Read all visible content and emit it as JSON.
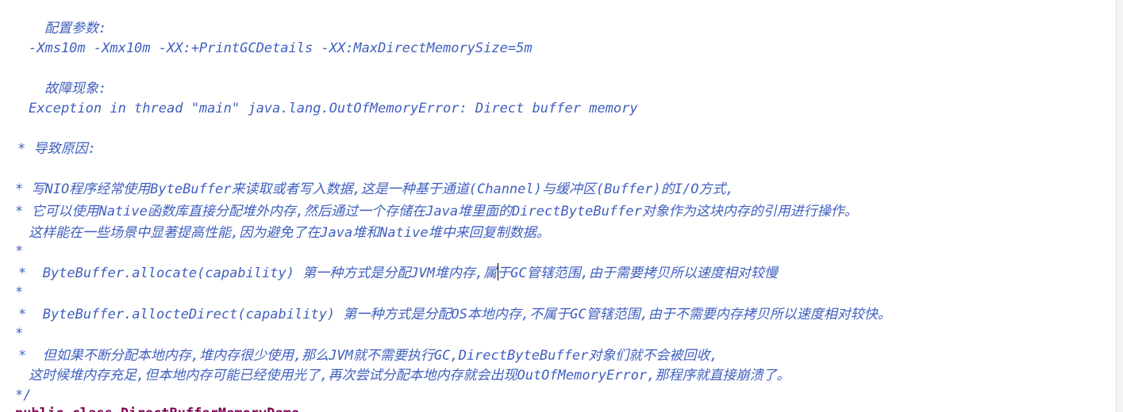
{
  "editor": {
    "text_color": "#3f5fbf",
    "lines": [
      "配置参数:",
      "-Xms10m -Xmx10m -XX:+PrintGCDetails -XX:MaxDirectMemorySize=5m",
      "故障现象:",
      "Exception in thread \"main\" java.lang.OutOfMemoryError: Direct buffer memory",
      "* 导致原因:",
      "* 写NIO程序经常使用ByteBuffer来读取或者写入数据,这是一种基于通道(Channel)与缓冲区(Buffer)的I/O方式,",
      "* 它可以使用Native函数库直接分配堆外内存,然后通过一个存储在Java堆里面的DirectByteBuffer对象作为这块内存的引用进行操作。",
      "这样能在一些场景中显著提高性能,因为避免了在Java堆和Native堆中来回复制数据。",
      "*",
      "*  ByteBuffer.allocate(capability) 第一种方式是分配JVM堆内存,属于GC管辖范围,由于需要拷贝所以速度相对较慢",
      "*",
      "*  ByteBuffer.allocteDirect(capability) 第一种方式是分配OS本地内存,不属于GC管辖范围,由于不需要内存拷贝所以速度相对较快。",
      "*",
      "*  但如果不断分配本地内存,堆内存很少使用,那么JVM就不需要执行GC,DirectByteBuffer对象们就不会被回收,",
      "这时候堆内存充足,但本地内存可能已经使用光了,再次尝试分配本地内存就会出现OutOfMemoryError,那程序就直接崩溃了。",
      "*/",
      "public class DirectBufferMemoryDemo"
    ]
  }
}
